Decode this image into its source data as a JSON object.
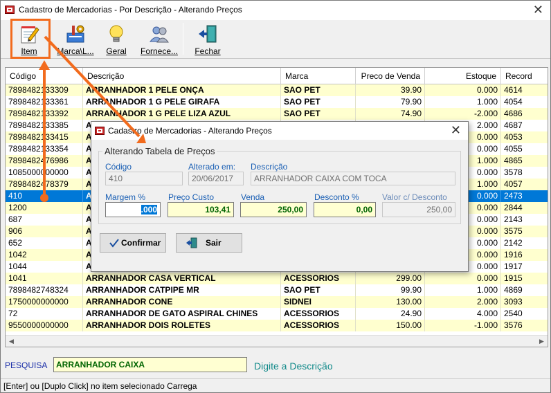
{
  "window": {
    "title": "Cadastro de Mercadorias - Por Descrição - Alterando Preços"
  },
  "toolbar": {
    "buttons": [
      {
        "label": "Item",
        "icon": "notepad-pencil-icon"
      },
      {
        "label": "Marca\\L...",
        "icon": "tools-icon"
      },
      {
        "label": "Geral",
        "icon": "lightbulb-icon"
      },
      {
        "label": "Fornece...",
        "icon": "users-icon"
      },
      {
        "label": "Fechar",
        "icon": "exit-door-icon"
      }
    ]
  },
  "grid": {
    "columns": [
      "Código",
      "Descrição",
      "Marca",
      "Preco de Venda",
      "Estoque",
      "Record"
    ],
    "rows": [
      {
        "codigo": "7898482133309",
        "descricao": "ARRANHADOR 1  PELE ONÇA",
        "marca": "SAO PET",
        "preco": "39.90",
        "estoque": "0.000",
        "record": "4614"
      },
      {
        "codigo": "7898482133361",
        "descricao": "ARRANHADOR 1 G PELE GIRAFA",
        "marca": "SAO PET",
        "preco": "79.90",
        "estoque": "1.000",
        "record": "4054"
      },
      {
        "codigo": "7898482133392",
        "descricao": "ARRANHADOR 1 G PELE LIZA AZUL",
        "marca": "SAO PET",
        "preco": "74.90",
        "estoque": "-2.000",
        "record": "4686"
      },
      {
        "codigo": "7898482133385",
        "descricao": "A",
        "marca": "",
        "preco": "",
        "estoque": "2.000",
        "record": "4687"
      },
      {
        "codigo": "7898482133415",
        "descricao": "A",
        "marca": "",
        "preco": "",
        "estoque": "0.000",
        "record": "4053"
      },
      {
        "codigo": "7898482133354",
        "descricao": "A",
        "marca": "",
        "preco": "",
        "estoque": "0.000",
        "record": "4055"
      },
      {
        "codigo": "7898482476986",
        "descricao": "A",
        "marca": "",
        "preco": "",
        "estoque": "1.000",
        "record": "4865"
      },
      {
        "codigo": "1085000000000",
        "descricao": "A",
        "marca": "",
        "preco": "",
        "estoque": "0.000",
        "record": "3578"
      },
      {
        "codigo": "7898482478379",
        "descricao": "A",
        "marca": "",
        "preco": "",
        "estoque": "1.000",
        "record": "4057"
      },
      {
        "codigo": "410",
        "descricao": "A",
        "marca": "",
        "preco": "",
        "estoque": "0.000",
        "record": "2473"
      },
      {
        "codigo": "1200",
        "descricao": "A",
        "marca": "",
        "preco": "",
        "estoque": "0.000",
        "record": "2844"
      },
      {
        "codigo": "687",
        "descricao": "A",
        "marca": "",
        "preco": "",
        "estoque": "0.000",
        "record": "2143"
      },
      {
        "codigo": "906",
        "descricao": "A",
        "marca": "",
        "preco": "",
        "estoque": "0.000",
        "record": "3575"
      },
      {
        "codigo": "652",
        "descricao": "A",
        "marca": "",
        "preco": "",
        "estoque": "0.000",
        "record": "2142"
      },
      {
        "codigo": "1042",
        "descricao": "A",
        "marca": "",
        "preco": "",
        "estoque": "0.000",
        "record": "1916"
      },
      {
        "codigo": "1044",
        "descricao": "A",
        "marca": "",
        "preco": "",
        "estoque": "0.000",
        "record": "1917"
      },
      {
        "codigo": "1041",
        "descricao": "ARRANHADOR CASA VERTICAL",
        "marca": "ACESSORIOS",
        "preco": "299.00",
        "estoque": "0.000",
        "record": "1915"
      },
      {
        "codigo": "7898482748324",
        "descricao": "ARRANHADOR CATPIPE MR",
        "marca": "SAO PET",
        "preco": "99.90",
        "estoque": "1.000",
        "record": "4869"
      },
      {
        "codigo": "1750000000000",
        "descricao": "ARRANHADOR CONE",
        "marca": "SIDNEI",
        "preco": "130.00",
        "estoque": "2.000",
        "record": "3093"
      },
      {
        "codigo": "72",
        "descricao": "ARRANHADOR DE GATO ASPIRAL CHINES",
        "marca": "ACESSORIOS",
        "preco": "24.90",
        "estoque": "4.000",
        "record": "2540"
      },
      {
        "codigo": "9550000000000",
        "descricao": "ARRANHADOR DOIS ROLETES",
        "marca": "ACESSORIOS",
        "preco": "150.00",
        "estoque": "-1.000",
        "record": "3576"
      }
    ]
  },
  "search": {
    "label": "PESQUISA",
    "value": "ARRANHADOR CAIXA",
    "hint": "Digite a Descrição"
  },
  "statusbar": {
    "text": "[Enter] ou [Duplo Click] no item selecionado Carrega"
  },
  "dialog": {
    "title": "Cadastro de Mercadorias - Alterando Preços",
    "group_title": "Alterando Tabela de Preços",
    "codigo_label": "Código",
    "codigo_value": "410",
    "alterado_label": "Alterado em:",
    "alterado_value": "20/06/2017",
    "descricao_label": "Descrição",
    "descricao_value": "ARRANHADOR CAIXA COM TOCA",
    "margem_label": "Margem %",
    "margem_value": ".000",
    "custo_label": "Preço Custo",
    "custo_value": "103,41",
    "venda_label": "Venda",
    "venda_value": "250,00",
    "desconto_label": "Desconto %",
    "desconto_value": "0,00",
    "valor_desc_label": "Valor c/ Desconto",
    "valor_desc_value": "250,00",
    "confirmar_label": "Confirmar",
    "confirmar_icon": "checkmark-icon",
    "sair_label": "Sair",
    "sair_icon": "exit-door-icon"
  },
  "colors": {
    "row_yellow": "#ffffcf",
    "selection": "#0078d7",
    "annotation": "#f26b1d",
    "edit_field": "#ffffd2",
    "value_green": "#006400"
  }
}
